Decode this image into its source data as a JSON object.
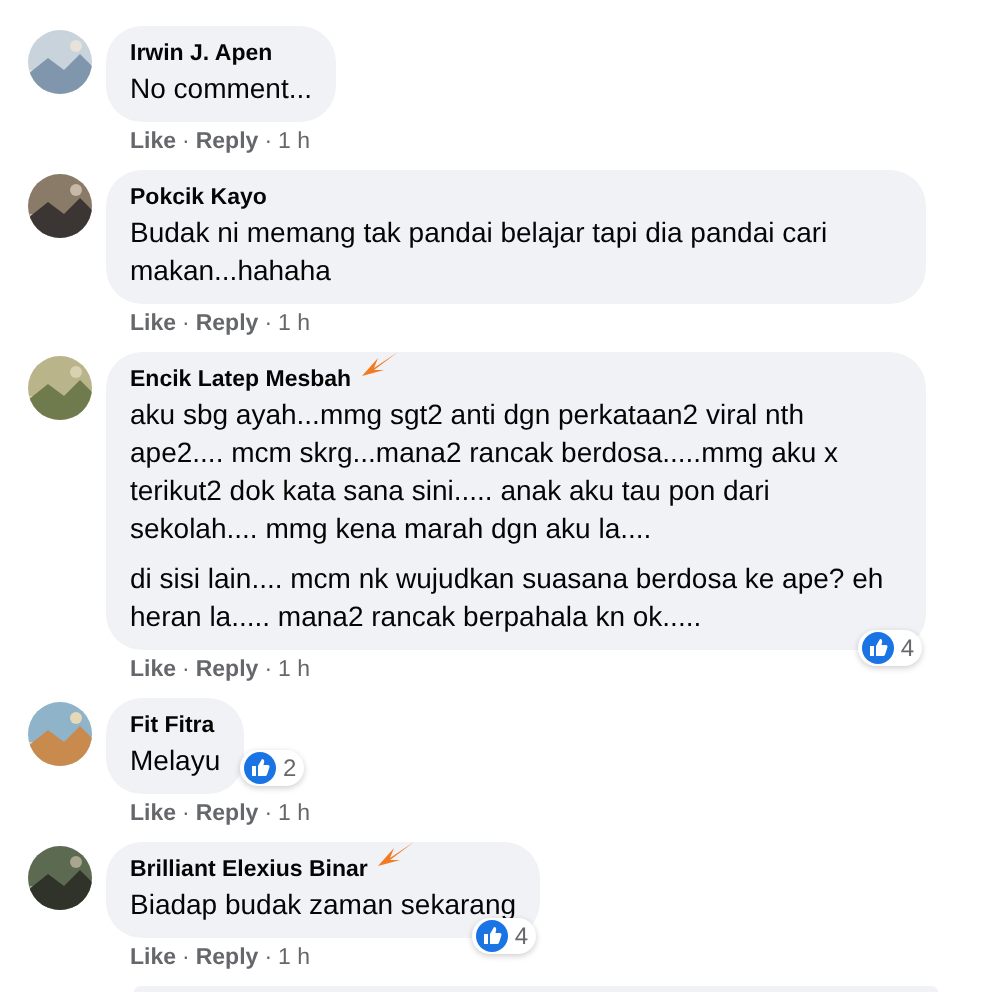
{
  "comments": [
    {
      "author": "Irwin J. Apen",
      "marked": false,
      "paragraphs": [
        "No comment..."
      ],
      "actions": [
        {
          "kind": "link",
          "text": "Like"
        },
        {
          "kind": "sep",
          "text": "·"
        },
        {
          "kind": "link",
          "text": "Reply"
        },
        {
          "kind": "sep",
          "text": "·"
        },
        {
          "kind": "time",
          "text": "1 h"
        }
      ]
    },
    {
      "author": "Pokcik Kayo",
      "marked": false,
      "paragraphs": [
        "Budak ni memang tak pandai belajar tapi dia pandai cari makan...hahaha"
      ],
      "actions": [
        {
          "kind": "link",
          "text": "Like"
        },
        {
          "kind": "sep",
          "text": "·"
        },
        {
          "kind": "link",
          "text": "Reply"
        },
        {
          "kind": "sep",
          "text": "·"
        },
        {
          "kind": "time",
          "text": "1 h"
        }
      ]
    },
    {
      "author": "Encik Latep Mesbah",
      "marked": true,
      "paragraphs": [
        "aku sbg ayah...mmg sgt2 anti dgn perkataan2 viral nth ape2.... mcm skrg...mana2 rancak berdosa.....mmg aku x terikut2 dok kata sana sini..... anak aku tau pon dari sekolah.... mmg kena marah dgn aku la....",
        "di sisi lain.... mcm nk wujudkan suasana berdosa ke ape? eh heran la..... mana2 rancak berpahala kn ok....."
      ],
      "reactions": "4",
      "actions": [
        {
          "kind": "link",
          "text": "Like"
        },
        {
          "kind": "sep",
          "text": "·"
        },
        {
          "kind": "link",
          "text": "Reply"
        },
        {
          "kind": "sep",
          "text": "·"
        },
        {
          "kind": "time",
          "text": "1 h"
        }
      ]
    },
    {
      "author": "Fit Fitra",
      "marked": false,
      "paragraphs": [
        "Melayu"
      ],
      "reactions": "2",
      "actions": [
        {
          "kind": "link",
          "text": "Like"
        },
        {
          "kind": "sep",
          "text": "·"
        },
        {
          "kind": "link",
          "text": "Reply"
        },
        {
          "kind": "sep",
          "text": "·"
        },
        {
          "kind": "time",
          "text": "1 h"
        }
      ]
    },
    {
      "author": "Brilliant Elexius Binar",
      "marked": true,
      "paragraphs": [
        "Biadap budak zaman sekarang"
      ],
      "reactions": "4",
      "actions": [
        {
          "kind": "link",
          "text": "Like"
        },
        {
          "kind": "sep",
          "text": "·"
        },
        {
          "kind": "link",
          "text": "Reply"
        },
        {
          "kind": "sep",
          "text": "·"
        },
        {
          "kind": "time",
          "text": "1 h"
        }
      ]
    }
  ]
}
